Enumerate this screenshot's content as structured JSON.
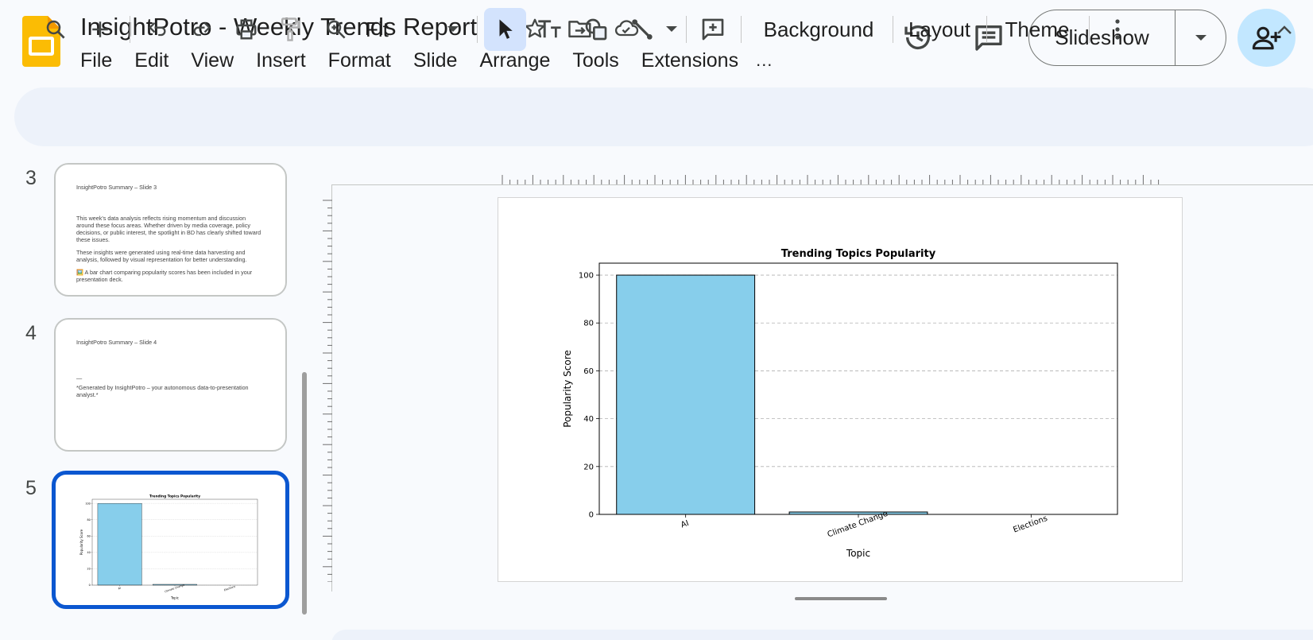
{
  "app": {
    "title": "InsightPotro - Weekly Trends Report",
    "brand_color": "#FBBC04",
    "title_icons": [
      "star-icon",
      "move-to-folder-icon",
      "cloud-saved-icon"
    ]
  },
  "menu": [
    "File",
    "Edit",
    "View",
    "Insert",
    "Format",
    "Slide",
    "Arrange",
    "Tools",
    "Extensions"
  ],
  "menu_more": "...",
  "header": {
    "slideshow_label": "Slideshow",
    "icons": [
      "history-icon",
      "comments-icon",
      "share-icon"
    ]
  },
  "toolbar": {
    "zoom_value": "Fit",
    "background_label": "Background",
    "layout_label": "Layout",
    "theme_label": "Theme"
  },
  "filmstrip": {
    "slides": [
      {
        "number": "3",
        "title": "InsightPotro Summary – Slide 3",
        "paragraphs": [
          "This week's data analysis reflects rising momentum and discussion around these focus areas. Whether driven by media coverage, policy decisions, or public interest, the spotlight in BD has clearly shifted toward these issues.",
          "These insights were generated using real-time data harvesting and analysis, followed by visual representation for better understanding.",
          "🖼️ A bar chart comparing popularity scores has been included in your presentation deck."
        ]
      },
      {
        "number": "4",
        "title": "InsightPotro Summary – Slide 4",
        "rule": "—",
        "paragraphs": [
          "*Generated by InsightPotro – your autonomous data-to-presentation analyst.*"
        ]
      },
      {
        "number": "5",
        "selected": true
      }
    ]
  },
  "chart_data": {
    "type": "bar",
    "title": "Trending Topics Popularity",
    "xlabel": "Topic",
    "ylabel": "Popularity Score",
    "categories": [
      "AI",
      "Climate Change",
      "Elections"
    ],
    "values": [
      100,
      1,
      0
    ],
    "ylim": [
      0,
      105
    ],
    "yticks": [
      0,
      20,
      40,
      60,
      80,
      100
    ],
    "bar_color": "#87CEEB",
    "grid": "y-dashed",
    "xtick_rotation": 20
  }
}
